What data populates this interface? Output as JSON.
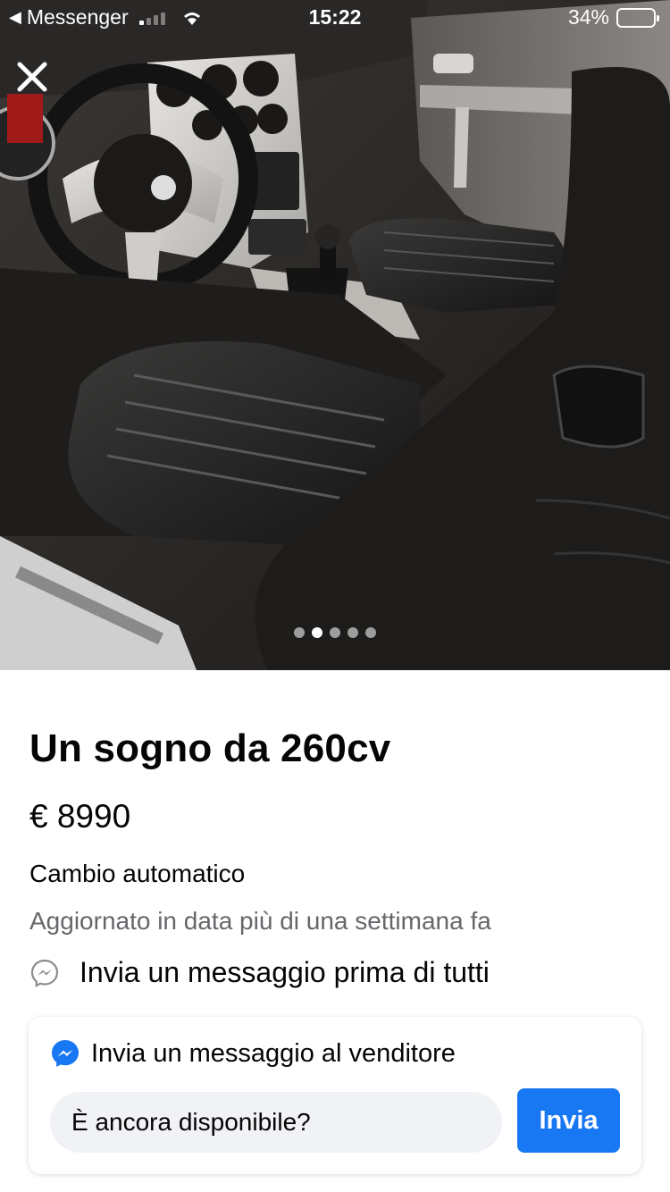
{
  "status_bar": {
    "back_app": "Messenger",
    "time": "15:22",
    "battery": "34%",
    "battery_level": 0.34
  },
  "photo": {
    "image_count": 5,
    "active_index": 1
  },
  "listing": {
    "title": "Un sogno da 260cv",
    "price": "€ 8990",
    "attribute": "Cambio automatico",
    "updated": "Aggiornato in data più di una settimana fa",
    "first_message_prompt": "Invia un messaggio prima di tutti"
  },
  "message_card": {
    "header": "Invia un messaggio al venditore",
    "input_value": "È ancora disponibile?",
    "send_label": "Invia"
  },
  "colors": {
    "accent": "#1877f2",
    "secondary_text": "#65676b",
    "input_bg": "#f0f2f5"
  }
}
